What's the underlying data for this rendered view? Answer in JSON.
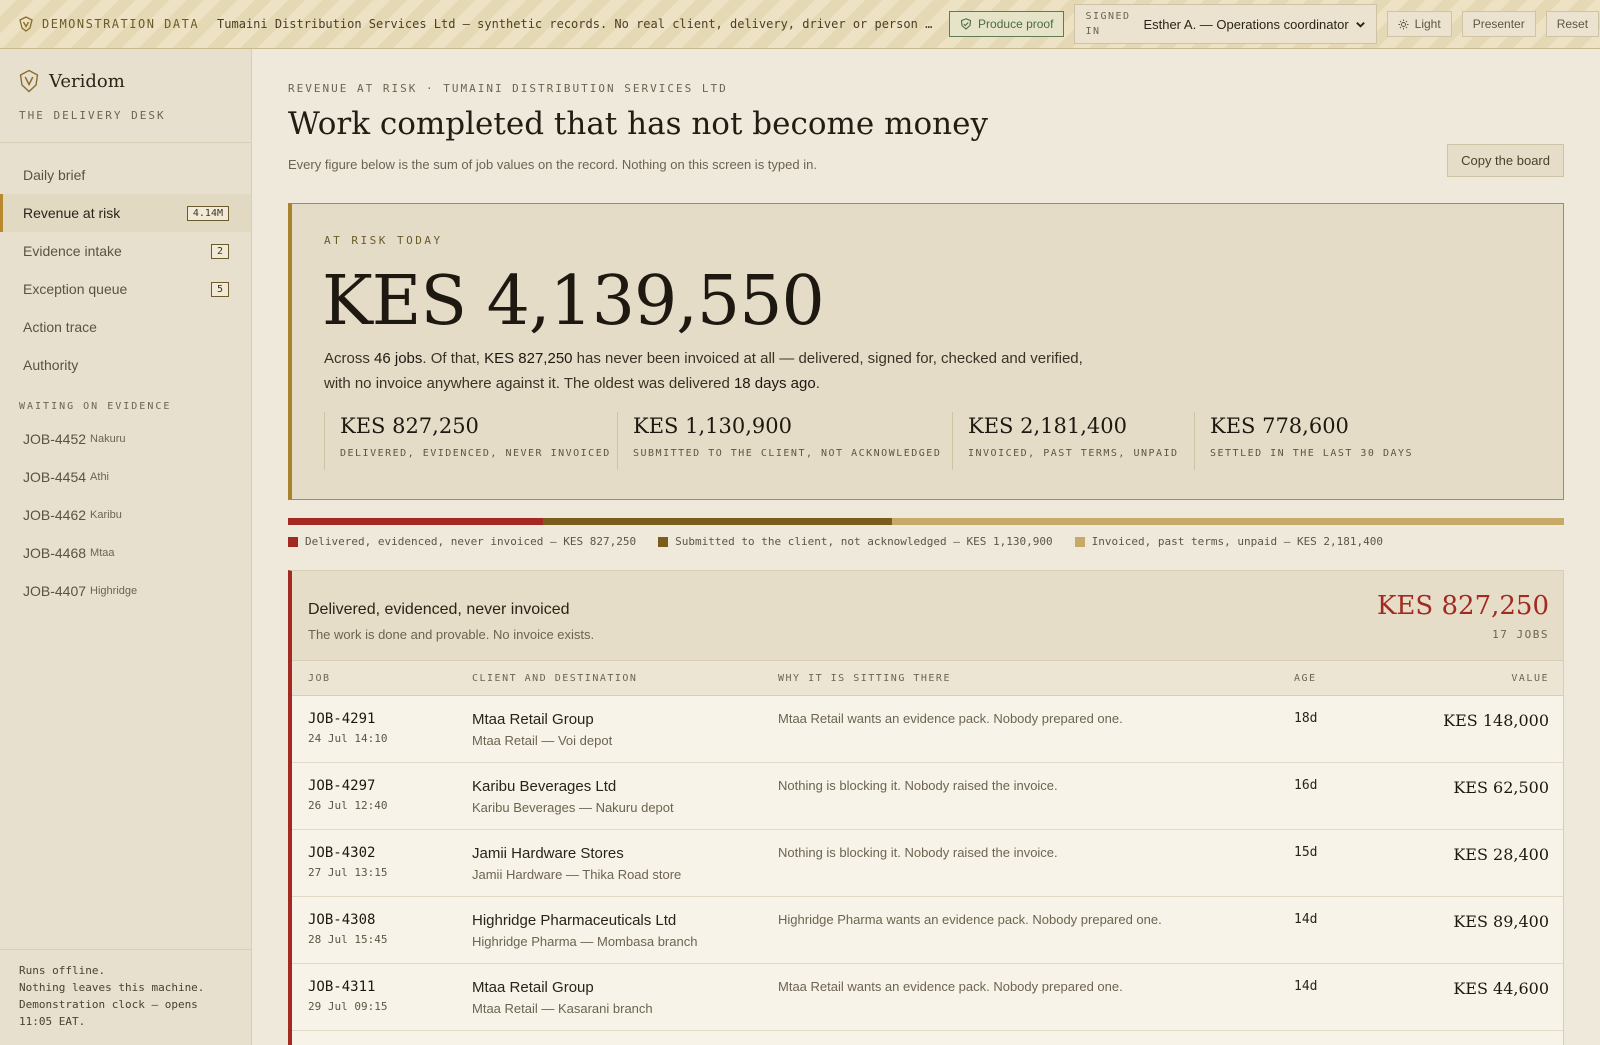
{
  "banner": {
    "badge": "DEMONSTRATION DATA",
    "note": "Tumaini Distribution Services Ltd — synthetic records. No real client, delivery, driver or person is represented.",
    "proof_label": "Produce proof",
    "signed_label": "SIGNED IN",
    "user": "Esther A. — Operations coordinator",
    "theme_label": "Light",
    "presenter_label": "Presenter",
    "reset_label": "Reset"
  },
  "sidebar": {
    "brand": "Veridom",
    "brand_sub": "THE DELIVERY DESK",
    "nav": [
      {
        "label": "Daily brief",
        "badge": ""
      },
      {
        "label": "Revenue at risk",
        "badge": "4.14M"
      },
      {
        "label": "Evidence intake",
        "badge": "2"
      },
      {
        "label": "Exception queue",
        "badge": "5"
      },
      {
        "label": "Action trace",
        "badge": ""
      },
      {
        "label": "Authority",
        "badge": ""
      }
    ],
    "waiting_heading": "WAITING ON EVIDENCE",
    "waiting": [
      {
        "job": "JOB-4452",
        "loc": "Nakuru"
      },
      {
        "job": "JOB-4454",
        "loc": "Athi"
      },
      {
        "job": "JOB-4462",
        "loc": "Karibu"
      },
      {
        "job": "JOB-4468",
        "loc": "Mtaa"
      },
      {
        "job": "JOB-4407",
        "loc": "Highridge"
      }
    ],
    "footer": [
      "Runs offline.",
      "Nothing leaves this machine.",
      "Demonstration clock — opens",
      "11:05 EAT."
    ]
  },
  "page": {
    "crumb": "REVENUE AT RISK · TUMAINI DISTRIBUTION SERVICES LTD",
    "title": "Work completed that has not become money",
    "subtitle": "Every figure below is the sum of job values on the record. Nothing on this screen is typed in.",
    "copy_label": "Copy the board"
  },
  "risk": {
    "label": "AT RISK TODAY",
    "amount": "KES 4,139,550",
    "desc": {
      "p1": "Across ",
      "jobs": "46 jobs",
      "p2": ". Of that, ",
      "uninvoiced": "KES 827,250",
      "p3": " has never been invoiced at all — delivered, signed for, checked and verified, with no invoice anywhere against it. The oldest was delivered ",
      "oldest": "18 days ago",
      "p4": "."
    },
    "stats": [
      {
        "value": "KES 827,250",
        "label": "DELIVERED, EVIDENCED, NEVER INVOICED"
      },
      {
        "value": "KES 1,130,900",
        "label": "SUBMITTED TO THE CLIENT, NOT ACKNOWLEDGED"
      },
      {
        "value": "KES 2,181,400",
        "label": "INVOICED, PAST TERMS, UNPAID"
      },
      {
        "value": "KES 778,600",
        "label": "SETTLED IN THE LAST 30 DAYS"
      }
    ]
  },
  "split": [
    {
      "label": "Delivered, evidenced, never invoiced — KES 827,250",
      "amount": 827250,
      "color": "#a22a22"
    },
    {
      "label": "Submitted to the client, not acknowledged — KES 1,130,900",
      "amount": 1130900,
      "color": "#7a5d1a"
    },
    {
      "label": "Invoiced, past terms, unpaid — KES 2,181,400",
      "amount": 2181400,
      "color": "#c7a968"
    }
  ],
  "panel": {
    "title": "Delivered, evidenced, never invoiced",
    "subtitle": "The work is done and provable. No invoice exists.",
    "amount": "KES 827,250",
    "jobs": "17 JOBS",
    "columns": {
      "job": "JOB",
      "client": "CLIENT AND DESTINATION",
      "why": "WHY IT IS SITTING THERE",
      "age": "AGE",
      "value": "VALUE"
    },
    "rows": [
      {
        "job": "JOB-4291",
        "date": "24 Jul 14:10",
        "client": "Mtaa Retail Group",
        "dest": "Mtaa Retail — Voi depot",
        "why": "Mtaa Retail wants an evidence pack. Nobody prepared one.",
        "age": "18d",
        "value": "KES 148,000"
      },
      {
        "job": "JOB-4297",
        "date": "26 Jul 12:40",
        "client": "Karibu Beverages Ltd",
        "dest": "Karibu Beverages — Nakuru depot",
        "why": "Nothing is blocking it. Nobody raised the invoice.",
        "age": "16d",
        "value": "KES 62,500"
      },
      {
        "job": "JOB-4302",
        "date": "27 Jul 13:15",
        "client": "Jamii Hardware Stores",
        "dest": "Jamii Hardware — Thika Road store",
        "why": "Nothing is blocking it. Nobody raised the invoice.",
        "age": "15d",
        "value": "KES 28,400"
      },
      {
        "job": "JOB-4308",
        "date": "28 Jul 15:45",
        "client": "Highridge Pharmaceuticals Ltd",
        "dest": "Highridge Pharma — Mombasa branch",
        "why": "Highridge Pharma wants an evidence pack. Nobody prepared one.",
        "age": "14d",
        "value": "KES 89,400"
      },
      {
        "job": "JOB-4311",
        "date": "29 Jul 09:15",
        "client": "Mtaa Retail Group",
        "dest": "Mtaa Retail — Kasarani branch",
        "why": "Mtaa Retail wants an evidence pack. Nobody prepared one.",
        "age": "14d",
        "value": "KES 44,600"
      }
    ]
  }
}
